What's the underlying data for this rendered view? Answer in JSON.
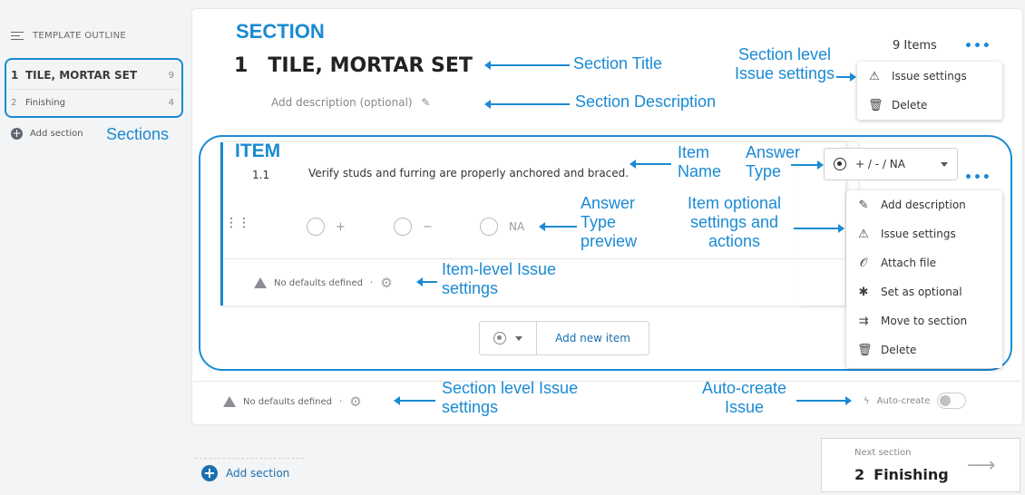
{
  "sidebar": {
    "header": "TEMPLATE OUTLINE",
    "sections": [
      {
        "num": "1",
        "name": "TILE, MORTAR SET",
        "count": "9"
      },
      {
        "num": "2",
        "name": "Finishing",
        "count": "4"
      }
    ],
    "add_section": "Add section"
  },
  "section": {
    "number": "1",
    "title": "TILE, MORTAR SET",
    "description_placeholder": "Add description (optional)",
    "items_count": "9 Items",
    "menu": [
      "Issue settings",
      "Delete"
    ],
    "no_defaults": "No defaults defined",
    "auto_create": "Auto-create"
  },
  "item": {
    "number": "1.1",
    "text": "Verify studs and furring are properly anchored and braced.",
    "answer_type": "+ / - / NA",
    "options": [
      "+",
      "−",
      "NA"
    ],
    "no_defaults": "No defaults defined",
    "menu": [
      "Add description",
      "Issue settings",
      "Attach file",
      "Set as optional",
      "Move to section",
      "Delete"
    ]
  },
  "add_item": {
    "label": "Add new item"
  },
  "footer": {
    "add_section": "Add section",
    "next_label": "Next section",
    "next_num": "2",
    "next_name": "Finishing"
  },
  "annotations": {
    "section": "SECTION",
    "item": "ITEM",
    "sections": "Sections",
    "section_title": "Section Title",
    "section_description": "Section Description",
    "section_issue_settings": "Section level Issue settings",
    "item_name": "Item Name",
    "answer_type": "Answer Type",
    "answer_type_preview": "Answer Type preview",
    "item_optional": "Item optional settings and actions",
    "item_issue_settings": "Item-level Issue settings",
    "section_issue_bottom": "Section level Issue settings",
    "auto_create": "Auto-create Issue"
  },
  "colors": {
    "accent": "#1a8ad4"
  }
}
